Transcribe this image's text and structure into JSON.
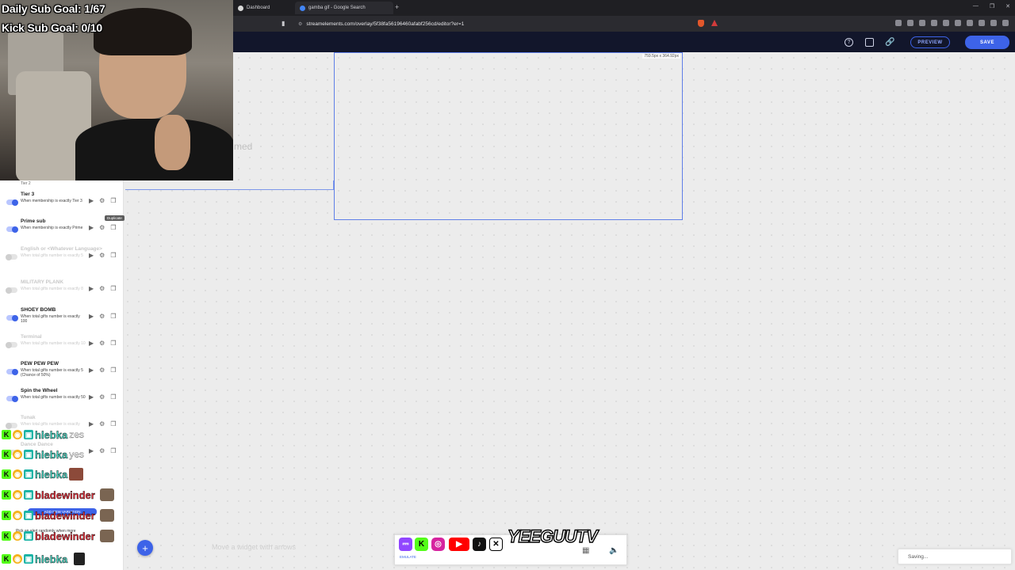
{
  "browser": {
    "tabs": [
      {
        "label": "Dashboard"
      },
      {
        "label": "gamba gif - Google Search"
      }
    ],
    "url": "streamelements.com/overlay/5f38fa56196460afabf256cd/editor?er=1"
  },
  "editor": {
    "preview_label": "PREVIEW",
    "save_label": "SAVE",
    "widget_dimensions": "759.5px x 364.92px",
    "ghost_text": "med",
    "hint": "Move a widget with arrows",
    "saving_status": "Saving..."
  },
  "overlay": {
    "daily_goal": "Daily Sub Goal: 1/67",
    "kick_goal": "Kick Sub Goal: 0/10"
  },
  "panel": {
    "partial_label": "Tier 2",
    "tooltip": "Duplicate",
    "variations": [
      {
        "name": "Tier 3",
        "desc": "When membership is exactly Tier 3",
        "enabled": true
      },
      {
        "name": "Prime sub",
        "desc": "When membership is exactly Prime",
        "enabled": true
      },
      {
        "name": "English or <Whatever Language>",
        "desc": "When total gifts number is exactly 5",
        "enabled": false
      },
      {
        "name": "MILITARY PLANK",
        "desc": "When total gifts number is exactly 8",
        "enabled": false
      },
      {
        "name": "SHOEY BOMB",
        "desc": "When total gifts number is exactly 100",
        "enabled": true
      },
      {
        "name": "Terminal",
        "desc": "When total gifts number is exactly 10",
        "enabled": false
      },
      {
        "name": "PEW PEW PEW",
        "desc": "When total gifts number is exactly 5 (Chance of 50%)",
        "enabled": true
      },
      {
        "name": "Spin the Wheel",
        "desc": "When total gifts number is exactly 50",
        "enabled": true
      },
      {
        "name": "Tunak",
        "desc": "When total gifts number is exactly",
        "enabled": false
      },
      {
        "name": "Dance Dance",
        "desc": "",
        "enabled": false
      }
    ],
    "add_variation_label": "ADD NEW VARIATION",
    "pick_hint": "Pick an alert randomly when more"
  },
  "chat": [
    {
      "user": "hlebka",
      "msg": "zes",
      "color": "#46d8c4"
    },
    {
      "user": "hlebka",
      "msg": "yes",
      "color": "#46d8c4"
    },
    {
      "user": "hlebka",
      "msg": "",
      "color": "#46d8c4"
    },
    {
      "user": "bladewinder",
      "msg": "",
      "color": "#e8343f"
    },
    {
      "user": "bladewinder",
      "msg": "",
      "color": "#e8343f"
    },
    {
      "user": "bladewinder",
      "msg": "",
      "color": "#e8343f"
    },
    {
      "user": "hlebka",
      "msg": "",
      "color": "#46d8c4"
    }
  ],
  "social": {
    "emulate_label": "EMULATE",
    "brand": "YEEGUUTV",
    "icons": [
      "twitch-icon",
      "kick-icon",
      "instagram-icon",
      "youtube-icon",
      "tiktok-icon",
      "x-icon"
    ]
  }
}
